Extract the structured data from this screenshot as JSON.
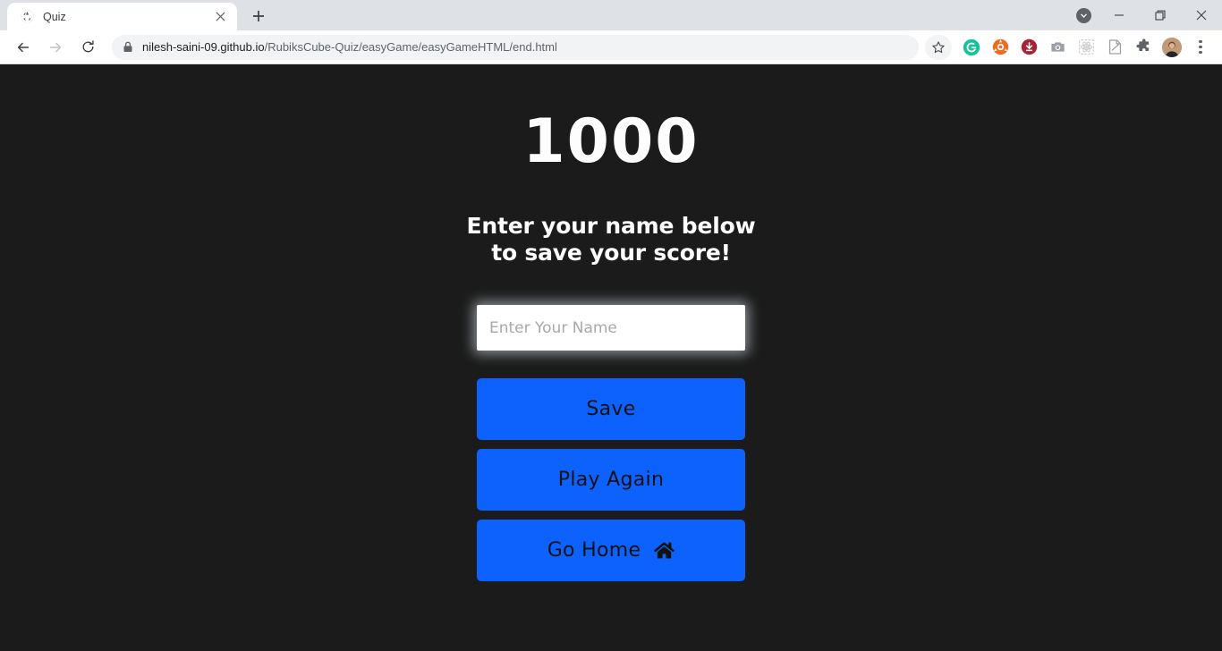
{
  "browser": {
    "tab": {
      "title": "Quiz",
      "favicon": "globe-icon",
      "close": "close-icon"
    },
    "newtab_label": "new-tab-icon",
    "window": {
      "minimize": "minimize-icon",
      "maximize": "maximize-icon",
      "close": "close-icon",
      "chevron": "chevron-down-icon"
    },
    "nav": {
      "back": "back-arrow-icon",
      "forward": "forward-arrow-icon",
      "reload": "reload-icon"
    },
    "omnibox": {
      "lock": "lock-icon",
      "url_domain": "nilesh-saini-09.github.io",
      "url_path": "/RubiksCube-Quiz/easyGame/easyGameHTML/end.html"
    },
    "extensions": [
      {
        "name": "bookmark-star-icon"
      },
      {
        "name": "grammarly-icon",
        "label": "G",
        "color": "#15c39a"
      },
      {
        "name": "orange-extension-icon",
        "color": "#f26a21"
      },
      {
        "name": "download-extension-icon",
        "color": "#a62436"
      },
      {
        "name": "screenshot-camera-icon",
        "color": "#9aa0a6"
      },
      {
        "name": "react-devtools-icon",
        "color": "#c9ccd0"
      },
      {
        "name": "note-extension-icon",
        "color": "#9aa0a6"
      },
      {
        "name": "puzzle-extensions-icon",
        "color": "#5f6368"
      }
    ],
    "profile_avatar": "user-avatar",
    "menu": "three-dot-menu-icon"
  },
  "page": {
    "score": "1000",
    "subtitle": "Enter your name below to save your score!",
    "name_input_placeholder": "Enter Your Name",
    "name_input_value": "",
    "buttons": [
      {
        "label": "Save",
        "name": "save-button"
      },
      {
        "label": "Play Again",
        "name": "play-again-button"
      },
      {
        "label": "Go Home",
        "name": "go-home-button",
        "icon": "home-icon"
      }
    ],
    "colors": {
      "background": "#1b1b1b",
      "button": "#0d62fd",
      "text": "#fdfdfd",
      "button_text": "#111111"
    }
  }
}
